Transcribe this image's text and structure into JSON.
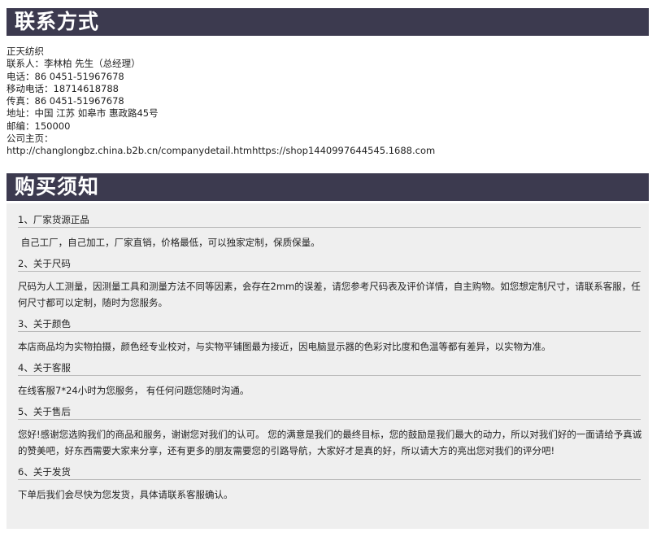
{
  "contact_section": {
    "header": "联系方式",
    "lines": [
      "正天纺织",
      "联系人：李林柏  先生（总经理）",
      "电话：86 0451-51967678",
      "移动电话：18714618788",
      "传真：86 0451-51967678",
      "地址：中国 江苏  如皋市 惠政路45号",
      "邮编：150000",
      "公司主页：",
      "http://changlongbz.china.b2b.cn/companydetail.htmhttps://shop1440997644545.1688.com"
    ]
  },
  "purchase_section": {
    "header": "购买须知",
    "items": [
      {
        "title": "1、厂家货源正品",
        "body": " 自己工厂，自己加工，厂家直销，价格最低，可以独家定制，保质保量。"
      },
      {
        "title": "2、关于尺码",
        "body": "尺码为人工测量，因测量工具和测量方法不同等因素，会存在2mm的误差，请您参考尺码表及评价详情，自主购物。如您想定制尺寸，请联系客服，任何尺寸都可以定制，随时为您服务。"
      },
      {
        "title": "3、关于颜色",
        "body": "本店商品均为实物拍摄，颜色经专业校对，与实物平铺图最为接近，因电脑显示器的色彩对比度和色温等都有差异，以实物为准。"
      },
      {
        "title": "4、关于客服",
        "body": "在线客服7*24小时为您服务， 有任何问题您随时沟通。"
      },
      {
        "title": "5、关于售后",
        "body": "您好!感谢您选购我们的商品和服务，谢谢您对我们的认可。 您的满意是我们的最终目标，您的鼓励是我们最大的动力，所以对我们好的一面请给予真诚的赞美吧，好东西需要大家来分享，还有更多的朋友需要您的引路导航，大家好才是真的好，所以请大方的亮出您对我们的评分吧!"
      },
      {
        "title": "6、关于发货",
        "body": "下单后我们会尽快为您发货，具体请联系客服确认。"
      }
    ]
  }
}
